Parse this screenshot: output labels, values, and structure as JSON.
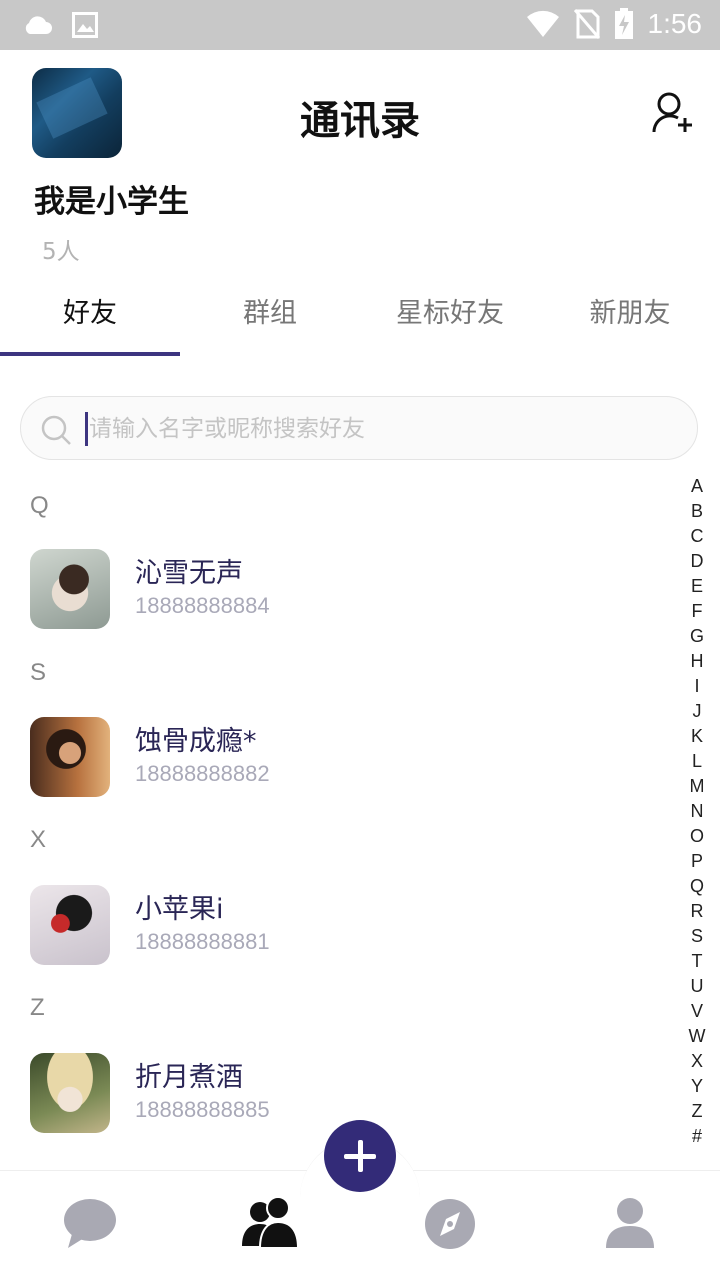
{
  "status_bar": {
    "time": "1:56"
  },
  "header": {
    "title": "通讯录",
    "group_name": "我是小学生",
    "member_count": "5人"
  },
  "tabs": [
    {
      "label": "好友",
      "active": true
    },
    {
      "label": "群组",
      "active": false
    },
    {
      "label": "星标好友",
      "active": false
    },
    {
      "label": "新朋友",
      "active": false
    }
  ],
  "search": {
    "placeholder": "请输入名字或昵称搜索好友",
    "value": ""
  },
  "sections": [
    {
      "letter": "Q",
      "contacts": [
        {
          "name": "沁雪无声",
          "phone": "18888888884"
        }
      ]
    },
    {
      "letter": "S",
      "contacts": [
        {
          "name": "蚀骨成瘾*",
          "phone": "18888888882"
        }
      ]
    },
    {
      "letter": "X",
      "contacts": [
        {
          "name": "小苹果i",
          "phone": "18888888881"
        }
      ]
    },
    {
      "letter": "Z",
      "contacts": [
        {
          "name": "折月煮酒",
          "phone": "18888888885"
        }
      ]
    }
  ],
  "alphabet_index": [
    "A",
    "B",
    "C",
    "D",
    "E",
    "F",
    "G",
    "H",
    "I",
    "J",
    "K",
    "L",
    "M",
    "N",
    "O",
    "P",
    "Q",
    "R",
    "S",
    "T",
    "U",
    "V",
    "W",
    "X",
    "Y",
    "Z",
    "#"
  ],
  "bottom_nav": [
    {
      "icon": "chat-bubble-icon",
      "active": false
    },
    {
      "icon": "contacts-icon",
      "active": true
    },
    {
      "icon": "compass-icon",
      "active": false
    },
    {
      "icon": "profile-icon",
      "active": false
    }
  ],
  "colors": {
    "accent": "#332b78",
    "tab_indicator": "#3d3580",
    "name_text": "#2a2656",
    "muted": "#a9a9b8"
  }
}
